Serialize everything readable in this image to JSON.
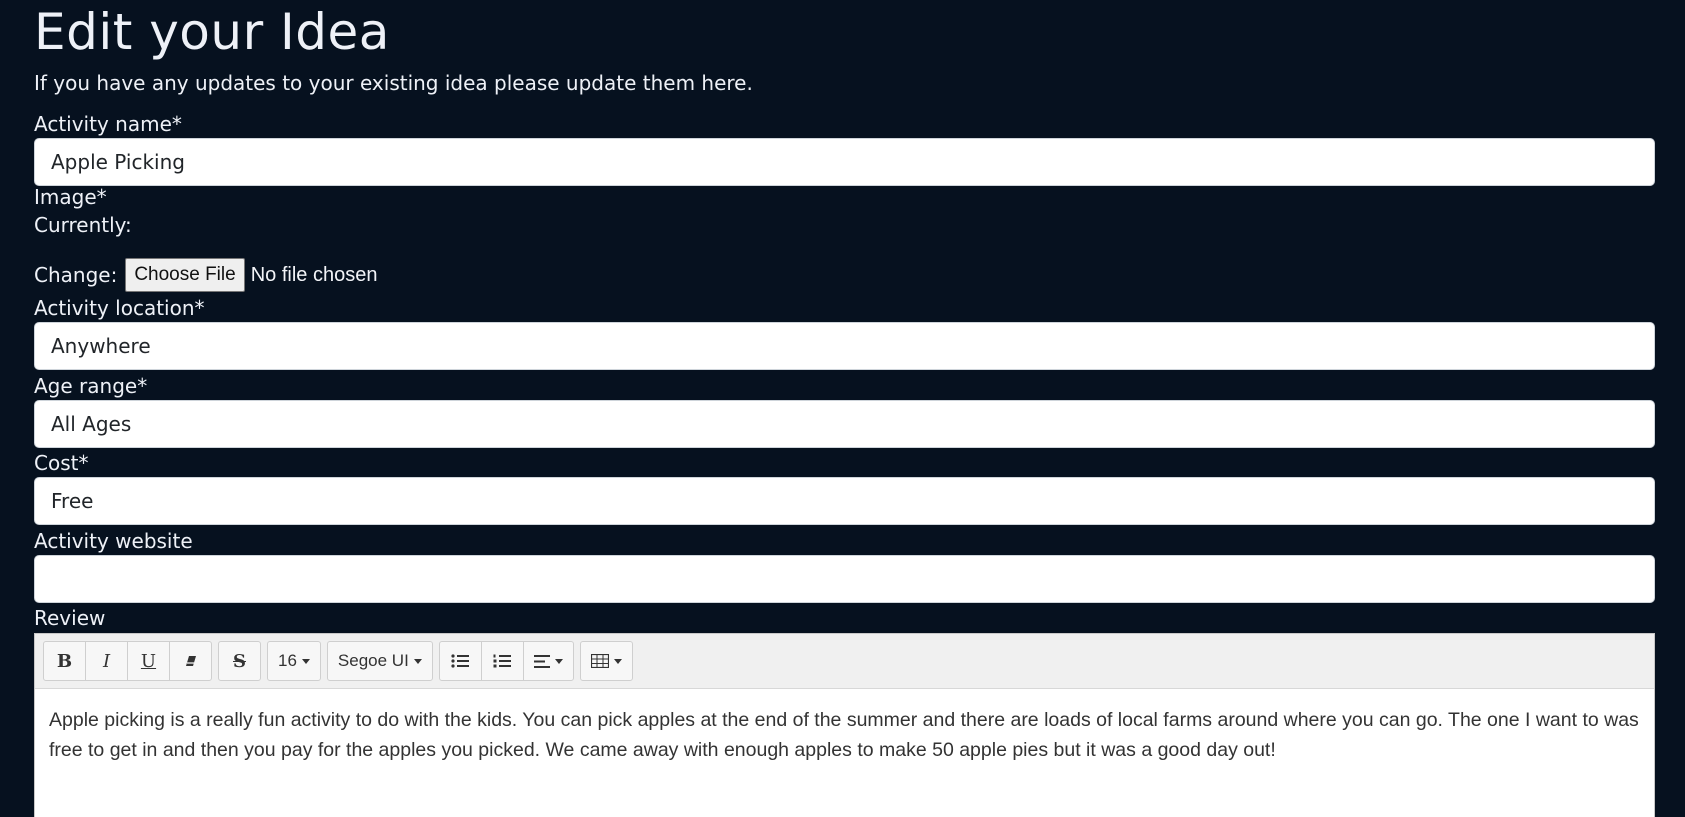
{
  "header": {
    "title": "Edit your Idea",
    "subtitle": "If you have any updates to your existing idea please update them here."
  },
  "form": {
    "activity_name": {
      "label": "Activity name*",
      "value": "Apple Picking"
    },
    "image": {
      "label": "Image*",
      "currently_label": "Currently:",
      "change_label": "Change:",
      "choose_button": "Choose File",
      "status": "No file chosen"
    },
    "location": {
      "label": "Activity location*",
      "value": "Anywhere"
    },
    "age_range": {
      "label": "Age range*",
      "value": "All Ages"
    },
    "cost": {
      "label": "Cost*",
      "value": "Free"
    },
    "website": {
      "label": "Activity website",
      "value": ""
    },
    "review": {
      "label": "Review",
      "toolbar": {
        "bold": "B",
        "italic": "I",
        "underline": "U",
        "strikethrough": "S",
        "font_size": "16",
        "font_family": "Segoe UI"
      },
      "text": "Apple picking is a really fun activity to do with the kids. You can pick apples at the end of the summer and there are loads of local farms around where you can go. The one I want to was free to get in and then you pay for the apples you picked. We came away with enough apples to make 50 apple pies but it was a good day out!"
    }
  },
  "colors": {
    "background": "#06111f",
    "text": "#eef1f7",
    "toolbar": "#f0f0f0"
  },
  "icons": [
    "eraser-icon",
    "unordered-list-icon",
    "ordered-list-icon",
    "align-left-icon",
    "table-icon"
  ]
}
